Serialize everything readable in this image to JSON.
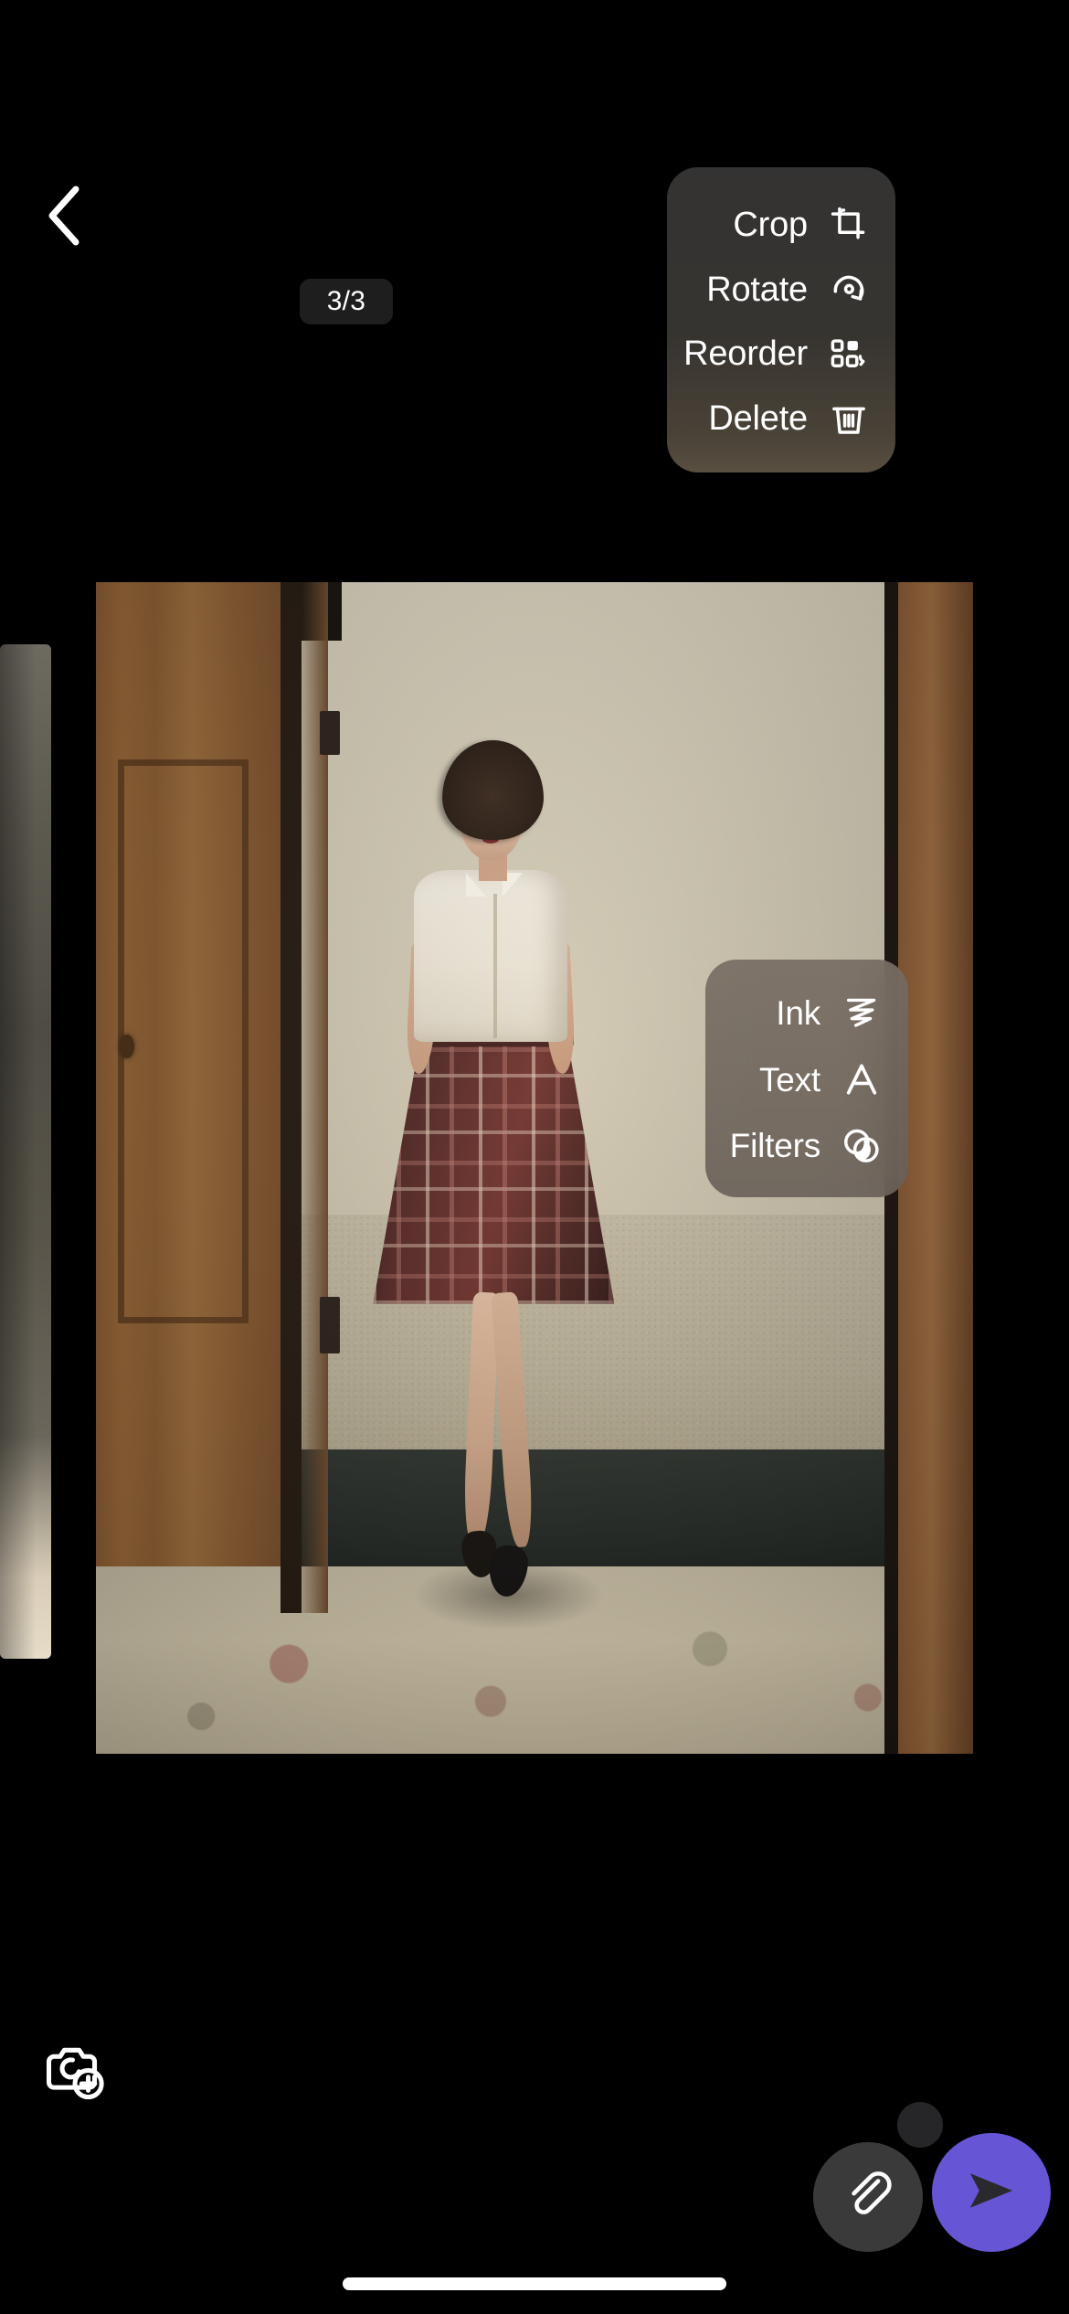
{
  "app": {
    "screen_name": "image-attachment-editor",
    "background_color": "#000000"
  },
  "header": {
    "back_icon": "chevron-left-icon",
    "counter": "3/3"
  },
  "carousel": {
    "current_index": 3,
    "total": 3,
    "previous_thumbnail_visible": true
  },
  "menus": [
    {
      "id": "edit-menu",
      "position": "top-right",
      "items": [
        {
          "label": "Crop",
          "icon": "crop-icon"
        },
        {
          "label": "Rotate",
          "icon": "rotate-icon"
        },
        {
          "label": "Reorder",
          "icon": "reorder-grid-icon"
        },
        {
          "label": "Delete",
          "icon": "trash-icon"
        }
      ]
    },
    {
      "id": "markup-menu",
      "position": "mid-right",
      "items": [
        {
          "label": "Ink",
          "icon": "scribble-icon"
        },
        {
          "label": "Text",
          "icon": "text-a-icon"
        },
        {
          "label": "Filters",
          "icon": "filters-circles-icon"
        }
      ]
    }
  ],
  "bottom_bar": {
    "camera_button": {
      "icon": "camera-plus-icon",
      "label": "Add photo"
    },
    "page_dot": {
      "icon": "page-indicator-dot"
    },
    "attach_button": {
      "icon": "paperclip-icon",
      "label": "Attach"
    },
    "send_button": {
      "icon": "send-arrow-icon",
      "label": "Send",
      "color": "#6655d4"
    },
    "home_indicator": true
  },
  "colors": {
    "background": "#000000",
    "counter_pill_bg": "#1e1e1f",
    "menu_top_bg": "#373636",
    "menu_bottom_bg": "#766c62",
    "attach_bg": "#3a3a3a",
    "send_accent": "#6655d4",
    "text_primary": "#ffffff"
  }
}
